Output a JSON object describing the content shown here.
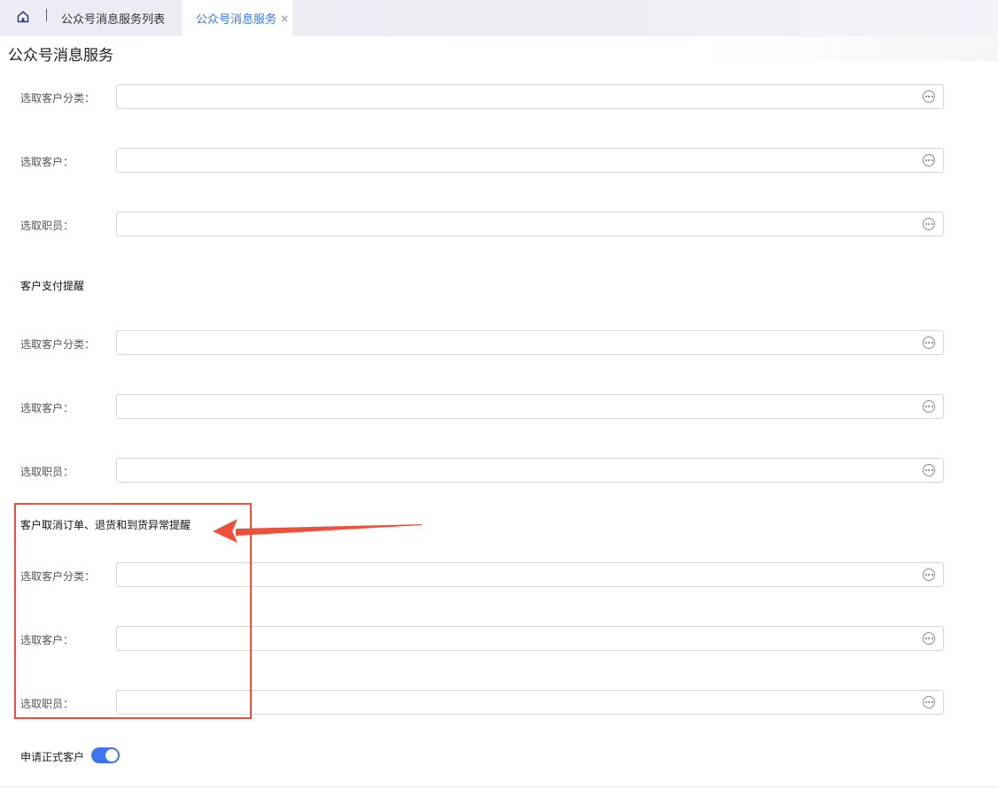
{
  "tabs": {
    "home_icon": "home-icon",
    "items": [
      {
        "label": "公众号消息服务列表"
      },
      {
        "label": "公众号消息服务",
        "active": true,
        "close": "×"
      }
    ]
  },
  "page": {
    "title": "公众号消息服务"
  },
  "groups": [
    {
      "title": "",
      "fields": [
        {
          "label": "选取客户分类：",
          "value": "",
          "icon": "ellipsis-icon"
        },
        {
          "label": "选取客户：",
          "value": "",
          "icon": "ellipsis-icon"
        },
        {
          "label": "选取职员：",
          "value": "",
          "icon": "ellipsis-icon"
        }
      ]
    },
    {
      "title": "客户支付提醒",
      "fields": [
        {
          "label": "选取客户分类：",
          "value": ""
        },
        {
          "label": "选取客户：",
          "value": ""
        },
        {
          "label": "选取职员：",
          "value": ""
        }
      ]
    },
    {
      "title": "客户取消订单、退货和到货异常提醒",
      "fields": [
        {
          "label": "选取客户分类：",
          "value": ""
        },
        {
          "label": "选取客户：",
          "value": ""
        },
        {
          "label": "选取职员：",
          "value": ""
        }
      ]
    }
  ],
  "toggle": {
    "label": "申请正式客户",
    "on": true
  },
  "colors": {
    "accent": "#3d75e8",
    "annotation": "#ee4f3b",
    "toggle_on": "#3d76ee"
  }
}
